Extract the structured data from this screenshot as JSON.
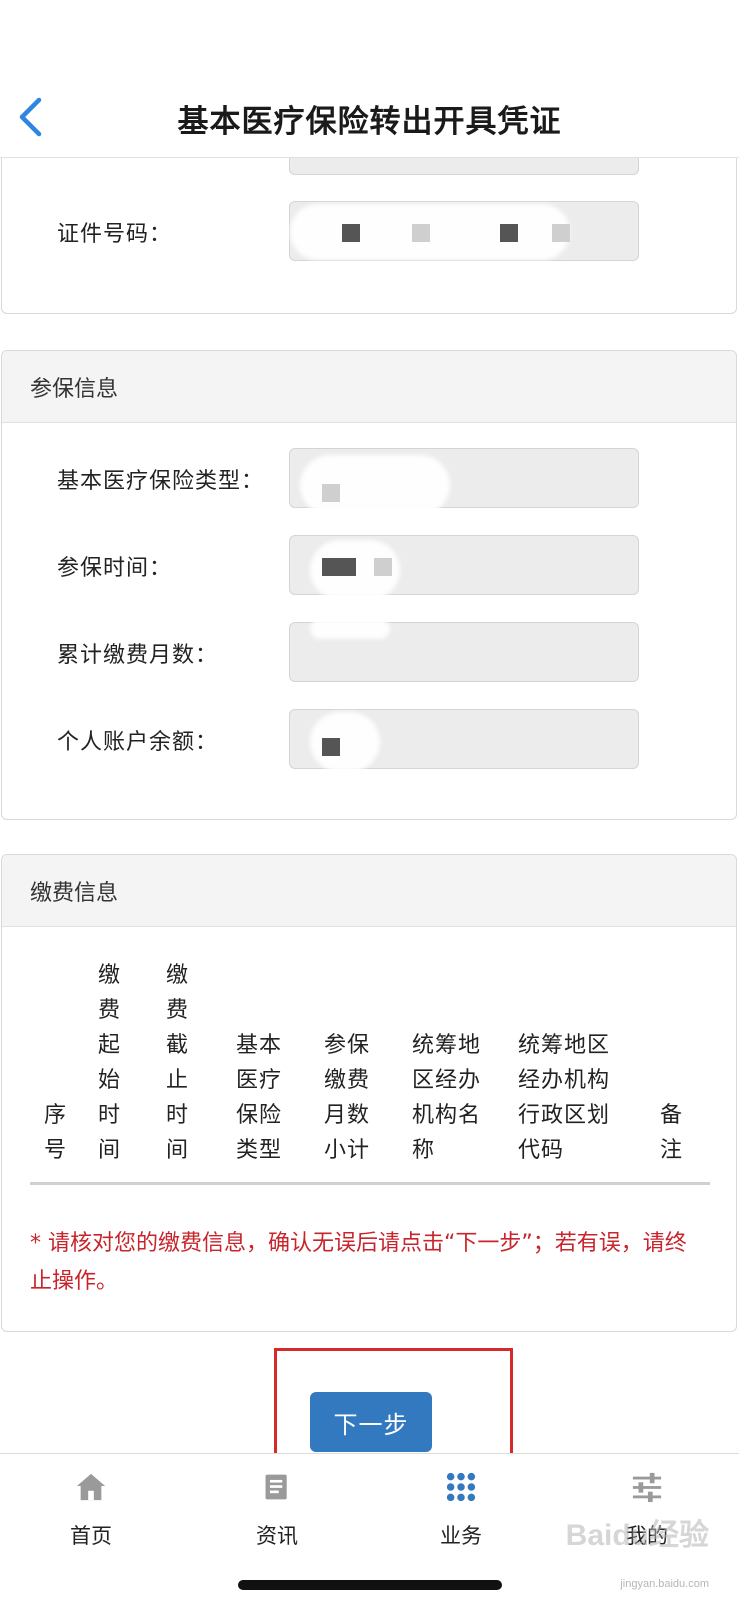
{
  "header": {
    "title": "基本医疗保险转出开具凭证"
  },
  "identity_card": {
    "id_number_label": "证件号码："
  },
  "insurance_card": {
    "title": "参保信息",
    "fields": [
      {
        "label": "基本医疗保险类型："
      },
      {
        "label": "参保时间："
      },
      {
        "label": "累计缴费月数："
      },
      {
        "label": "个人账户余额："
      }
    ]
  },
  "payment_card": {
    "title": "缴费信息",
    "columns": [
      {
        "label": "序\n号"
      },
      {
        "label": "缴\n费\n起\n始\n时\n间"
      },
      {
        "label": "缴\n费\n截\n止\n时\n间"
      },
      {
        "label": "基本\n医疗\n保险\n类型"
      },
      {
        "label": "参保\n缴费\n月数\n小计"
      },
      {
        "label": "统筹地\n区经办\n机构名\n称"
      },
      {
        "label": "统筹地区\n经办机构\n行政区划\n代码"
      },
      {
        "label": "备\n注"
      }
    ],
    "notice": "* 请核对您的缴费信息，确认无误后请点击“下一步”；若有误，请终止操作。"
  },
  "actions": {
    "next_label": "下一步"
  },
  "tabbar": {
    "items": [
      {
        "label": "首页",
        "icon": "home-icon"
      },
      {
        "label": "资讯",
        "icon": "news-icon"
      },
      {
        "label": "业务",
        "icon": "grid-icon",
        "active": true
      },
      {
        "label": "我的",
        "icon": "sliders-icon"
      }
    ]
  },
  "watermark": {
    "brand": "Baidu经验",
    "url": "jingyan.baidu.com"
  },
  "colors": {
    "primary": "#3379c0",
    "notice": "#c8242c",
    "highlight_box": "#d42a2a",
    "back_arrow": "#2f86e0"
  }
}
